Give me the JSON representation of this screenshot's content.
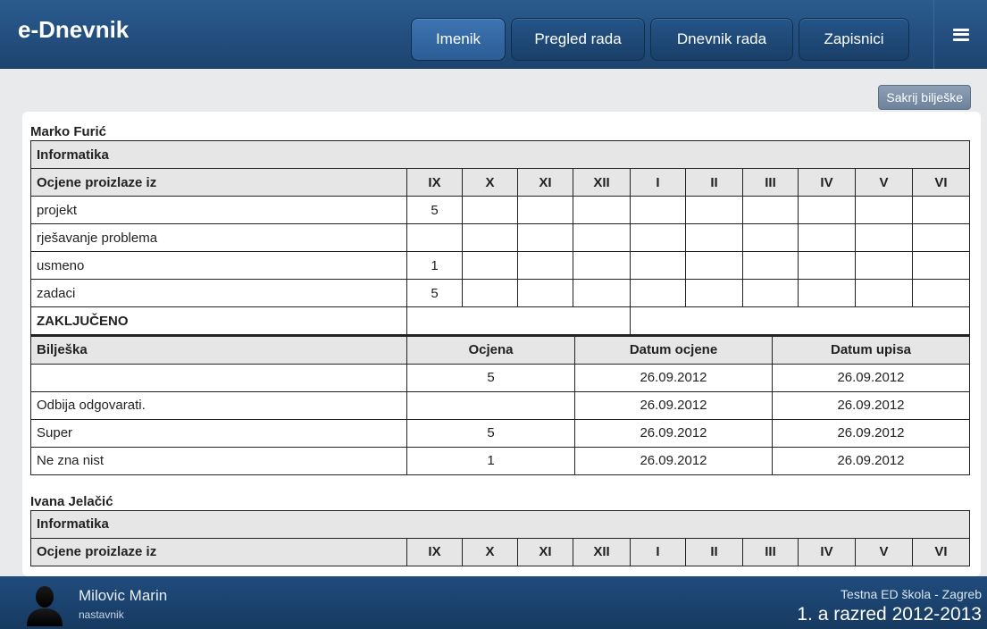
{
  "app": {
    "title": "e-Dnevnik"
  },
  "nav": {
    "items": [
      {
        "label": "Imenik"
      },
      {
        "label": "Pregled rada"
      },
      {
        "label": "Dnevnik rada"
      },
      {
        "label": "Zapisnici"
      }
    ],
    "menu_icon": "hamburger-icon"
  },
  "toolbar": {
    "hide_notes_label": "Sakrij bilješke"
  },
  "table_labels": {
    "grades_from": "Ocjene proizlaze iz",
    "months": [
      "IX",
      "X",
      "XI",
      "XII",
      "I",
      "II",
      "III",
      "IV",
      "V",
      "VI"
    ],
    "closed": "ZAKLJUČENO",
    "note": "Bilješka",
    "grade": "Ocjena",
    "grade_date": "Datum ocjene",
    "entry_date": "Datum upisa"
  },
  "students": [
    {
      "name": "Marko Furić",
      "subject": "Informatika",
      "rows": [
        {
          "label": "projekt",
          "grades": [
            "5",
            "",
            "",
            "",
            "",
            "",
            "",
            "",
            "",
            ""
          ]
        },
        {
          "label": "rješavanje problema",
          "grades": [
            "",
            "",
            "",
            "",
            "",
            "",
            "",
            "",
            "",
            ""
          ]
        },
        {
          "label": "usmeno",
          "grades": [
            "1",
            "",
            "",
            "",
            "",
            "",
            "",
            "",
            "",
            ""
          ]
        },
        {
          "label": "zadaci",
          "grades": [
            "5",
            "",
            "",
            "",
            "",
            "",
            "",
            "",
            "",
            ""
          ]
        }
      ],
      "notes": [
        {
          "note": "",
          "grade": "5",
          "grade_date": "26.09.2012",
          "entry_date": "26.09.2012"
        },
        {
          "note": "Odbija odgovarati.",
          "grade": "",
          "grade_date": "26.09.2012",
          "entry_date": "26.09.2012"
        },
        {
          "note": "Super",
          "grade": "5",
          "grade_date": "26.09.2012",
          "entry_date": "26.09.2012"
        },
        {
          "note": "Ne zna nist",
          "grade": "1",
          "grade_date": "26.09.2012",
          "entry_date": "26.09.2012"
        }
      ]
    },
    {
      "name": "Ivana Jelačić",
      "subject": "Informatika"
    }
  ],
  "footer": {
    "user_name": "Milovic Marin",
    "user_role": "nastavnik",
    "school": "Testna ED škola - Zagreb",
    "class_info": "1. a razred 2012-2013",
    "avatar_icon": "user-silhouette-icon"
  },
  "colors": {
    "header": "#1d4470",
    "header_button_active": "#3c74b2",
    "table_header_bg": "#e6e6e6",
    "page_bg": "#e9eaec",
    "footer": "#173a61"
  }
}
